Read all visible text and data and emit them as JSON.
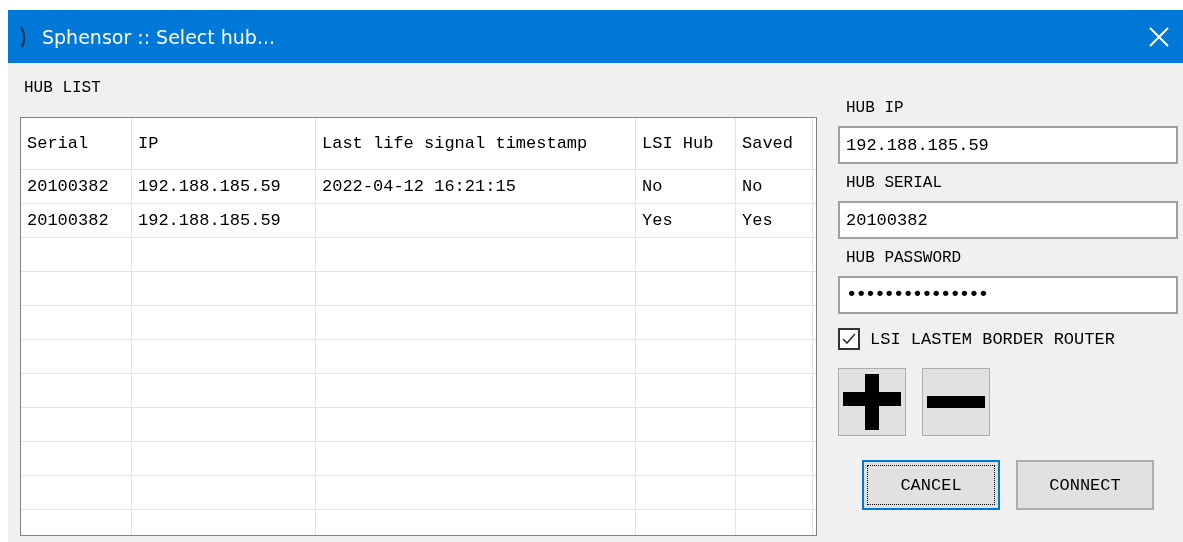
{
  "window": {
    "title": "Sphensor :: Select hub..."
  },
  "hub_list": {
    "label": "HUB LIST",
    "columns": [
      "Serial",
      "IP",
      "Last life signal timestamp",
      "LSI Hub",
      "Saved"
    ],
    "rows": [
      [
        "20100382",
        "192.188.185.59",
        "2022-04-12 16:21:15",
        "No",
        "No"
      ],
      [
        "20100382",
        "192.188.185.59",
        "",
        "Yes",
        "Yes"
      ]
    ]
  },
  "form": {
    "fields": [
      {
        "label": "HUB IP",
        "value": "192.188.185.59",
        "kind": "text"
      },
      {
        "label": "HUB SERIAL",
        "value": "20100382",
        "kind": "text"
      },
      {
        "label": "HUB PASSWORD",
        "value": "•••••••••••••••",
        "kind": "password"
      }
    ],
    "checkbox": {
      "label": "LSI LASTEM BORDER ROUTER",
      "checked": true
    }
  },
  "tool_buttons": [
    {
      "kind": "add"
    },
    {
      "kind": "remove"
    }
  ],
  "buttons": [
    {
      "label": "CANCEL",
      "focused": true
    },
    {
      "label": "CONNECT",
      "focused": false
    }
  ]
}
